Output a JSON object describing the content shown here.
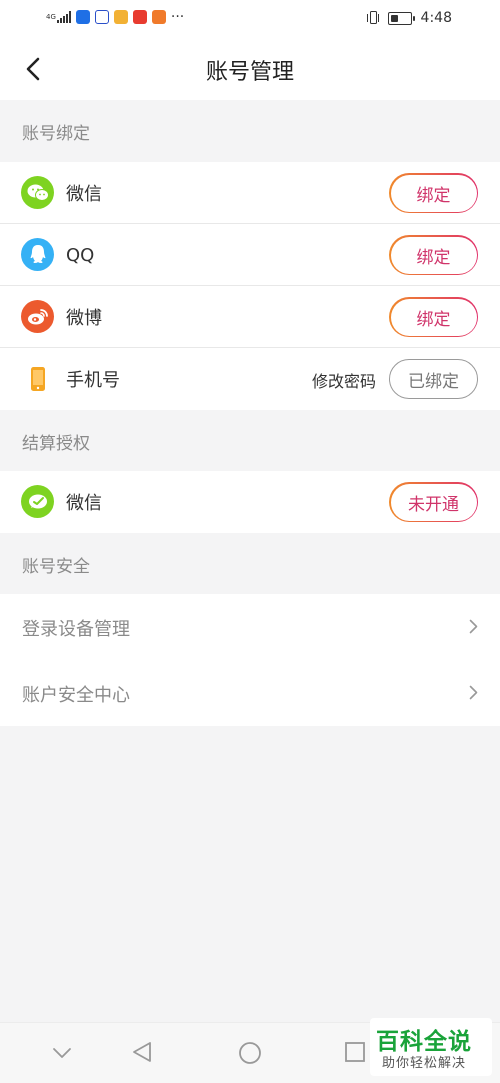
{
  "status_bar": {
    "signal_label": "4G",
    "time": "4:48",
    "more_dots": "···",
    "battery_level": 0.35
  },
  "header": {
    "title": "账号管理"
  },
  "account_binding": {
    "section_title": "账号绑定",
    "items": [
      {
        "label": "微信",
        "icon": "wechat-icon",
        "button": "绑定",
        "icon_color": "#7ed321"
      },
      {
        "label": "QQ",
        "icon": "qq-icon",
        "button": "绑定",
        "icon_color": "#35b1f5"
      },
      {
        "label": "微博",
        "icon": "weibo-icon",
        "button": "绑定",
        "icon_color": "#ec5a2e"
      }
    ],
    "phone": {
      "label": "手机号",
      "icon": "phone-icon",
      "change_password": "修改密码",
      "button": "已绑定",
      "icon_color": "#f5a623"
    }
  },
  "settlement": {
    "section_title": "结算授权",
    "items": [
      {
        "label": "微信",
        "icon": "wechat-pay-icon",
        "button": "未开通",
        "icon_color": "#7ed321"
      }
    ]
  },
  "security": {
    "section_title": "账号安全",
    "items": [
      {
        "label": "登录设备管理"
      },
      {
        "label": "账户安全中心"
      }
    ]
  },
  "watermark": {
    "title": "百科全说",
    "subtitle": "助你轻松解决"
  },
  "colors": {
    "accent_gradient_start": "#f08a2c",
    "accent_gradient_end": "#e0306a",
    "accent_text": "#d0346a",
    "background": "#f4f4f5"
  }
}
